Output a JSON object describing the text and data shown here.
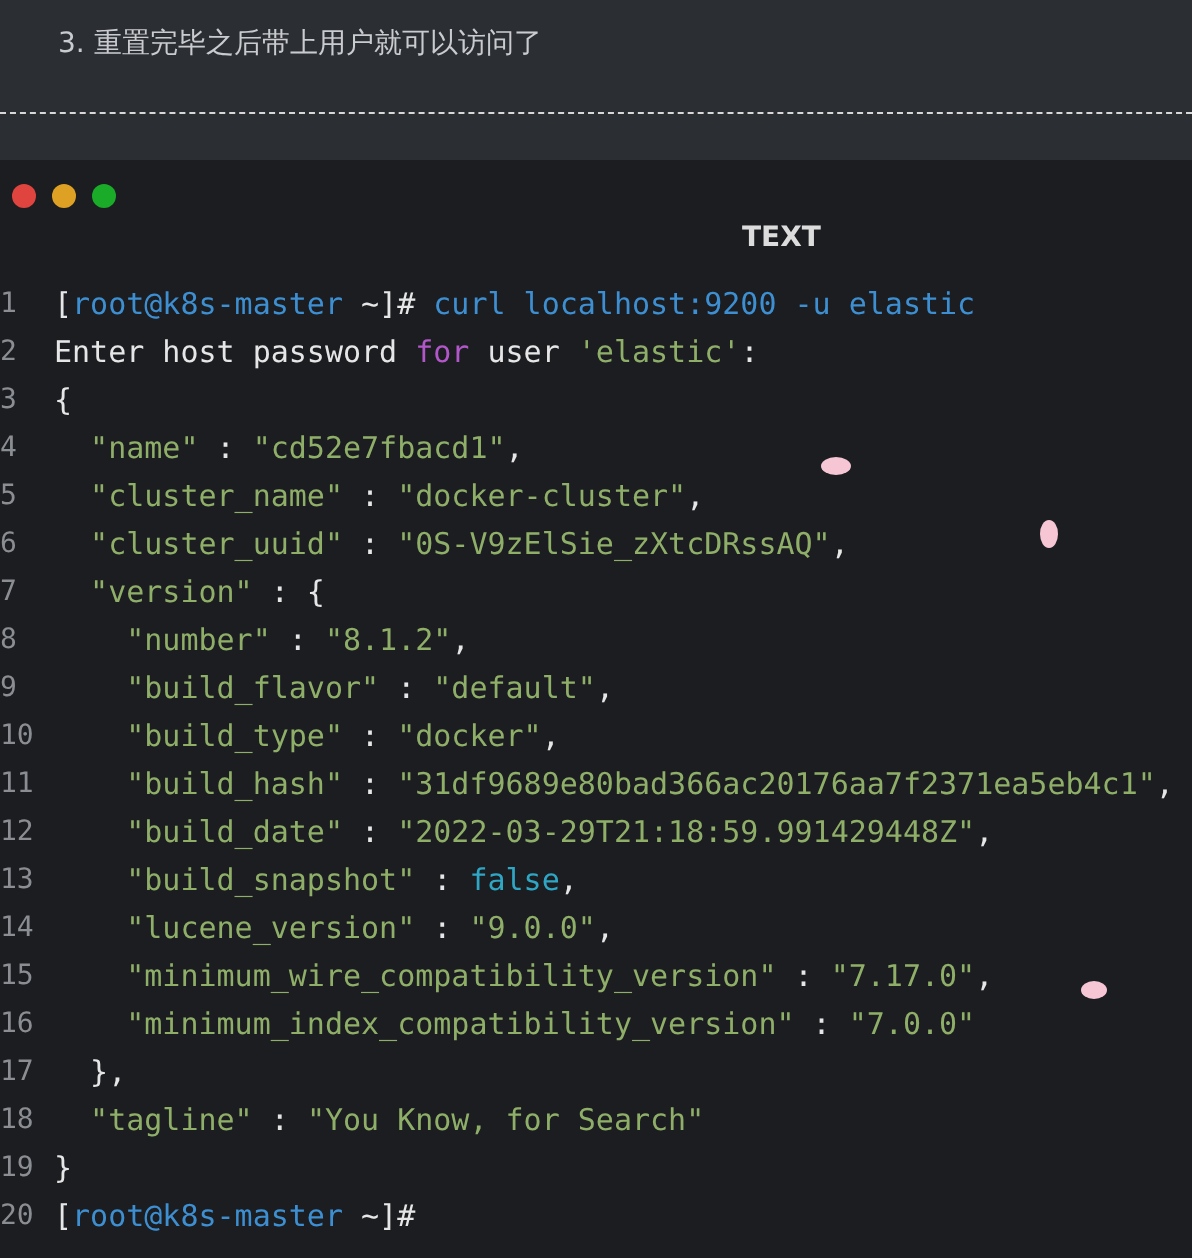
{
  "note": "3. 重置完毕之后带上用户就可以访问了",
  "code_block": {
    "window_buttons": [
      {
        "color": "#e0443e"
      },
      {
        "color": "#dea123"
      },
      {
        "color": "#1aab29"
      }
    ],
    "language": "TEXT",
    "lines": [
      {
        "number": "1",
        "tokens": [
          {
            "kind": "plain",
            "text": "["
          },
          {
            "kind": "prompt",
            "text": "root@k8s-master"
          },
          {
            "kind": "plain",
            "text": " ~]# "
          },
          {
            "kind": "prompt",
            "text": "curl localhost:9200 -u elastic"
          }
        ]
      },
      {
        "number": "2",
        "tokens": [
          {
            "kind": "plain",
            "text": "Enter host password "
          },
          {
            "kind": "keyword",
            "text": "for"
          },
          {
            "kind": "plain",
            "text": " user "
          },
          {
            "kind": "string",
            "text": "'elastic'"
          },
          {
            "kind": "plain",
            "text": ":"
          }
        ]
      },
      {
        "number": "3",
        "tokens": [
          {
            "kind": "plain",
            "text": "{"
          }
        ]
      },
      {
        "number": "4",
        "tokens": [
          {
            "kind": "string",
            "text": "  \"name\""
          },
          {
            "kind": "plain",
            "text": " : "
          },
          {
            "kind": "string",
            "text": "\"cd52e7fbacd1\""
          },
          {
            "kind": "plain",
            "text": ","
          }
        ]
      },
      {
        "number": "5",
        "tokens": [
          {
            "kind": "string",
            "text": "  \"cluster_name\""
          },
          {
            "kind": "plain",
            "text": " : "
          },
          {
            "kind": "string",
            "text": "\"docker-cluster\""
          },
          {
            "kind": "plain",
            "text": ","
          }
        ]
      },
      {
        "number": "6",
        "tokens": [
          {
            "kind": "string",
            "text": "  \"cluster_uuid\""
          },
          {
            "kind": "plain",
            "text": " : "
          },
          {
            "kind": "string",
            "text": "\"0S-V9zElSie_zXtcDRssAQ\""
          },
          {
            "kind": "plain",
            "text": ","
          }
        ]
      },
      {
        "number": "7",
        "tokens": [
          {
            "kind": "string",
            "text": "  \"version\""
          },
          {
            "kind": "plain",
            "text": " : {"
          }
        ]
      },
      {
        "number": "8",
        "tokens": [
          {
            "kind": "string",
            "text": "    \"number\""
          },
          {
            "kind": "plain",
            "text": " : "
          },
          {
            "kind": "string",
            "text": "\"8.1.2\""
          },
          {
            "kind": "plain",
            "text": ","
          }
        ]
      },
      {
        "number": "9",
        "tokens": [
          {
            "kind": "string",
            "text": "    \"build_flavor\""
          },
          {
            "kind": "plain",
            "text": " : "
          },
          {
            "kind": "string",
            "text": "\"default\""
          },
          {
            "kind": "plain",
            "text": ","
          }
        ]
      },
      {
        "number": "10",
        "tokens": [
          {
            "kind": "string",
            "text": "    \"build_type\""
          },
          {
            "kind": "plain",
            "text": " : "
          },
          {
            "kind": "string",
            "text": "\"docker\""
          },
          {
            "kind": "plain",
            "text": ","
          }
        ]
      },
      {
        "number": "11",
        "tokens": [
          {
            "kind": "string",
            "text": "    \"build_hash\""
          },
          {
            "kind": "plain",
            "text": " : "
          },
          {
            "kind": "string",
            "text": "\"31df9689e80bad366ac20176aa7f2371ea5eb4c1\""
          },
          {
            "kind": "plain",
            "text": ","
          }
        ]
      },
      {
        "number": "12",
        "tokens": [
          {
            "kind": "string",
            "text": "    \"build_date\""
          },
          {
            "kind": "plain",
            "text": " : "
          },
          {
            "kind": "string",
            "text": "\"2022-03-29T21:18:59.991429448Z\""
          },
          {
            "kind": "plain",
            "text": ","
          }
        ]
      },
      {
        "number": "13",
        "tokens": [
          {
            "kind": "string",
            "text": "    \"build_snapshot\""
          },
          {
            "kind": "plain",
            "text": " : "
          },
          {
            "kind": "literal",
            "text": "false"
          },
          {
            "kind": "plain",
            "text": ","
          }
        ]
      },
      {
        "number": "14",
        "tokens": [
          {
            "kind": "string",
            "text": "    \"lucene_version\""
          },
          {
            "kind": "plain",
            "text": " : "
          },
          {
            "kind": "string",
            "text": "\"9.0.0\""
          },
          {
            "kind": "plain",
            "text": ","
          }
        ]
      },
      {
        "number": "15",
        "tokens": [
          {
            "kind": "string",
            "text": "    \"minimum_wire_compatibility_version\""
          },
          {
            "kind": "plain",
            "text": " : "
          },
          {
            "kind": "string",
            "text": "\"7.17.0\""
          },
          {
            "kind": "plain",
            "text": ","
          }
        ]
      },
      {
        "number": "16",
        "tokens": [
          {
            "kind": "string",
            "text": "    \"minimum_index_compatibility_version\""
          },
          {
            "kind": "plain",
            "text": " : "
          },
          {
            "kind": "string",
            "text": "\"7.0.0\""
          }
        ]
      },
      {
        "number": "17",
        "tokens": [
          {
            "kind": "plain",
            "text": "  },"
          }
        ]
      },
      {
        "number": "18",
        "tokens": [
          {
            "kind": "string",
            "text": "  \"tagline\""
          },
          {
            "kind": "plain",
            "text": " : "
          },
          {
            "kind": "string",
            "text": "\"You Know, for Search\""
          }
        ]
      },
      {
        "number": "19",
        "tokens": [
          {
            "kind": "plain",
            "text": "}"
          }
        ]
      },
      {
        "number": "20",
        "tokens": [
          {
            "kind": "plain",
            "text": "["
          },
          {
            "kind": "prompt",
            "text": "root@k8s-master"
          },
          {
            "kind": "plain",
            "text": " ~]#"
          }
        ]
      }
    ]
  }
}
